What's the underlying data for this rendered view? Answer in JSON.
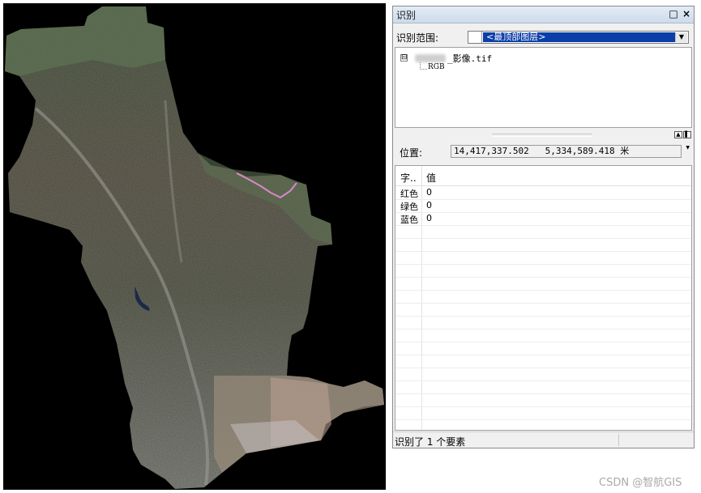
{
  "window": {
    "title": "识别",
    "pin_icon": "□",
    "close_icon": "×"
  },
  "identify_from": {
    "label": "识别范围:",
    "selected": "<最顶部图层>"
  },
  "tree": {
    "expander": "⊟",
    "file_name": "_影像.tif",
    "child": "RGB"
  },
  "location": {
    "label": "位置:",
    "value": "14,417,337.502   5,334,589.418 米"
  },
  "grid": {
    "columns": [
      "字..",
      "值"
    ],
    "rows": [
      {
        "field": "红色",
        "value": "0"
      },
      {
        "field": "绿色",
        "value": "0"
      },
      {
        "field": "蓝色",
        "value": "0"
      }
    ]
  },
  "status": {
    "text": "识别了 1 个要素"
  },
  "watermark": "CSDN @智航GIS",
  "colors": {
    "map_background": "#000000",
    "selection": "#0a3ea8",
    "titlebar": "#d6e2f0"
  }
}
